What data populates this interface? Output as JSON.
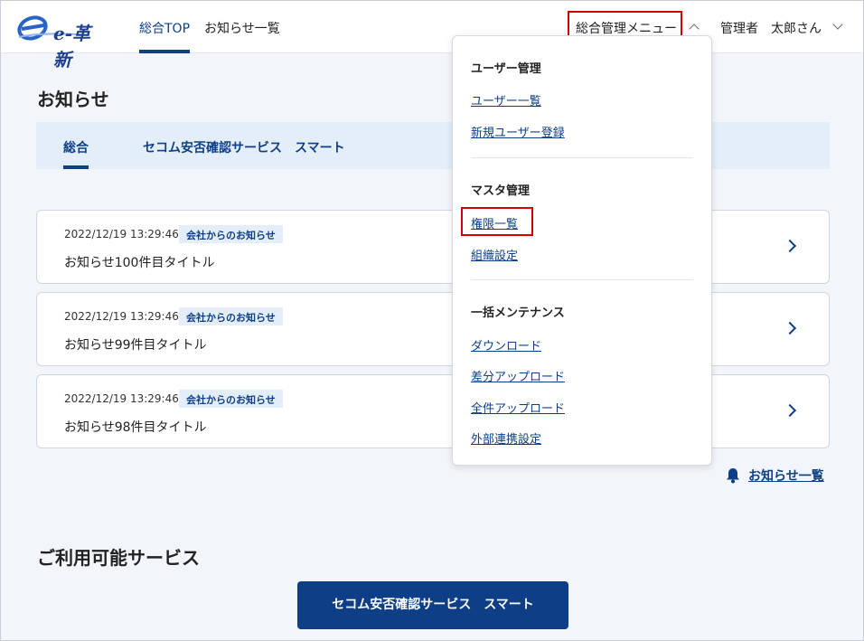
{
  "header": {
    "logo_text": "e-革新",
    "nav": [
      {
        "label": "総合TOP"
      },
      {
        "label": "お知らせ一覧"
      }
    ],
    "admin_menu_label": "総合管理メニュー",
    "role": "管理者",
    "user": "太郎さん"
  },
  "news": {
    "title": "お知らせ",
    "tabs": [
      {
        "label": "総合"
      },
      {
        "label": "セコム安否確認サービス　スマート"
      }
    ],
    "items": [
      {
        "date": "2022/12/19 13:29:46",
        "badge": "会社からのお知らせ",
        "title": "お知らせ100件目タイトル"
      },
      {
        "date": "2022/12/19 13:29:46",
        "badge": "会社からのお知らせ",
        "title": "お知らせ99件目タイトル"
      },
      {
        "date": "2022/12/19 13:29:46",
        "badge": "会社からのお知らせ",
        "title": "お知らせ98件目タイトル"
      }
    ],
    "list_link": "お知らせ一覧"
  },
  "services": {
    "title": "ご利用可能サービス",
    "button": "セコム安否確認サービス　スマート"
  },
  "dropdown": {
    "groups": [
      {
        "heading": "ユーザー管理",
        "links": [
          "ユーザー一覧",
          "新規ユーザー登録"
        ]
      },
      {
        "heading": "マスタ管理",
        "links": [
          "権限一覧",
          "組織設定"
        ]
      },
      {
        "heading": "一括メンテナンス",
        "links": [
          "ダウンロード",
          "差分アップロード",
          "全件アップロード",
          "外部連携設定"
        ]
      }
    ]
  },
  "colors": {
    "primary": "#0e3f86",
    "highlight": "#d40000",
    "tab_bg": "#e3eef9",
    "page_bg": "#f2f5f9"
  }
}
